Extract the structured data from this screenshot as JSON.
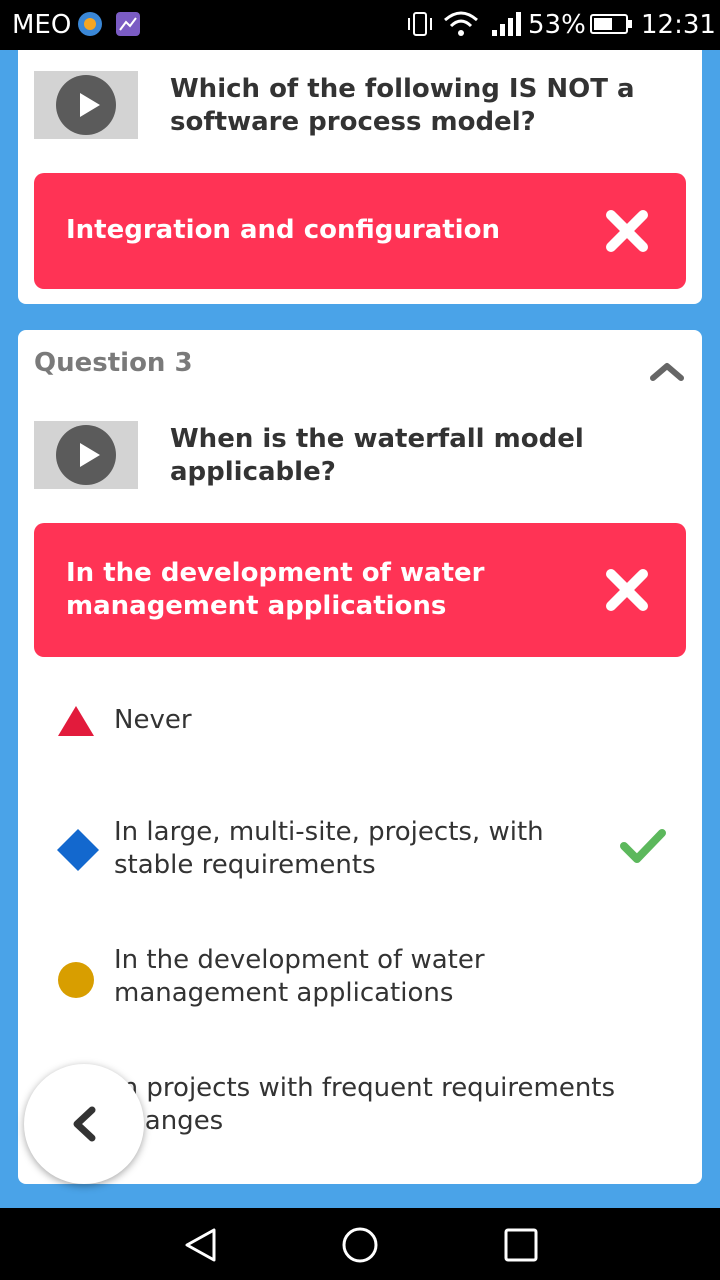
{
  "status_bar": {
    "carrier": "MEO",
    "battery_percent": "53%",
    "time": "12:31"
  },
  "previous_question": {
    "text": "Which of the following IS NOT a software process model?",
    "selected_answer": "Integration and configuration",
    "selected_correct": false
  },
  "question3": {
    "label": "Question 3",
    "text": "When is the waterfall model applicable?",
    "selected_answer": "In the development of water management applications",
    "selected_correct": false,
    "options": [
      {
        "shape": "triangle",
        "color": "#e21b3c",
        "text": "Never",
        "correct": false
      },
      {
        "shape": "diamond",
        "color": "#1368ce",
        "text": "In large, multi-site, projects, with stable requirements",
        "correct": true
      },
      {
        "shape": "circle",
        "color": "#d89e00",
        "text": "In the development of water management applications",
        "correct": false
      },
      {
        "shape": "square",
        "color": "#26890c",
        "text": "In projects with frequent requirements changes",
        "correct": false
      }
    ]
  },
  "colors": {
    "wrong": "#ff3355",
    "correct_check": "#5cb85c",
    "background": "#4aa3e8"
  }
}
